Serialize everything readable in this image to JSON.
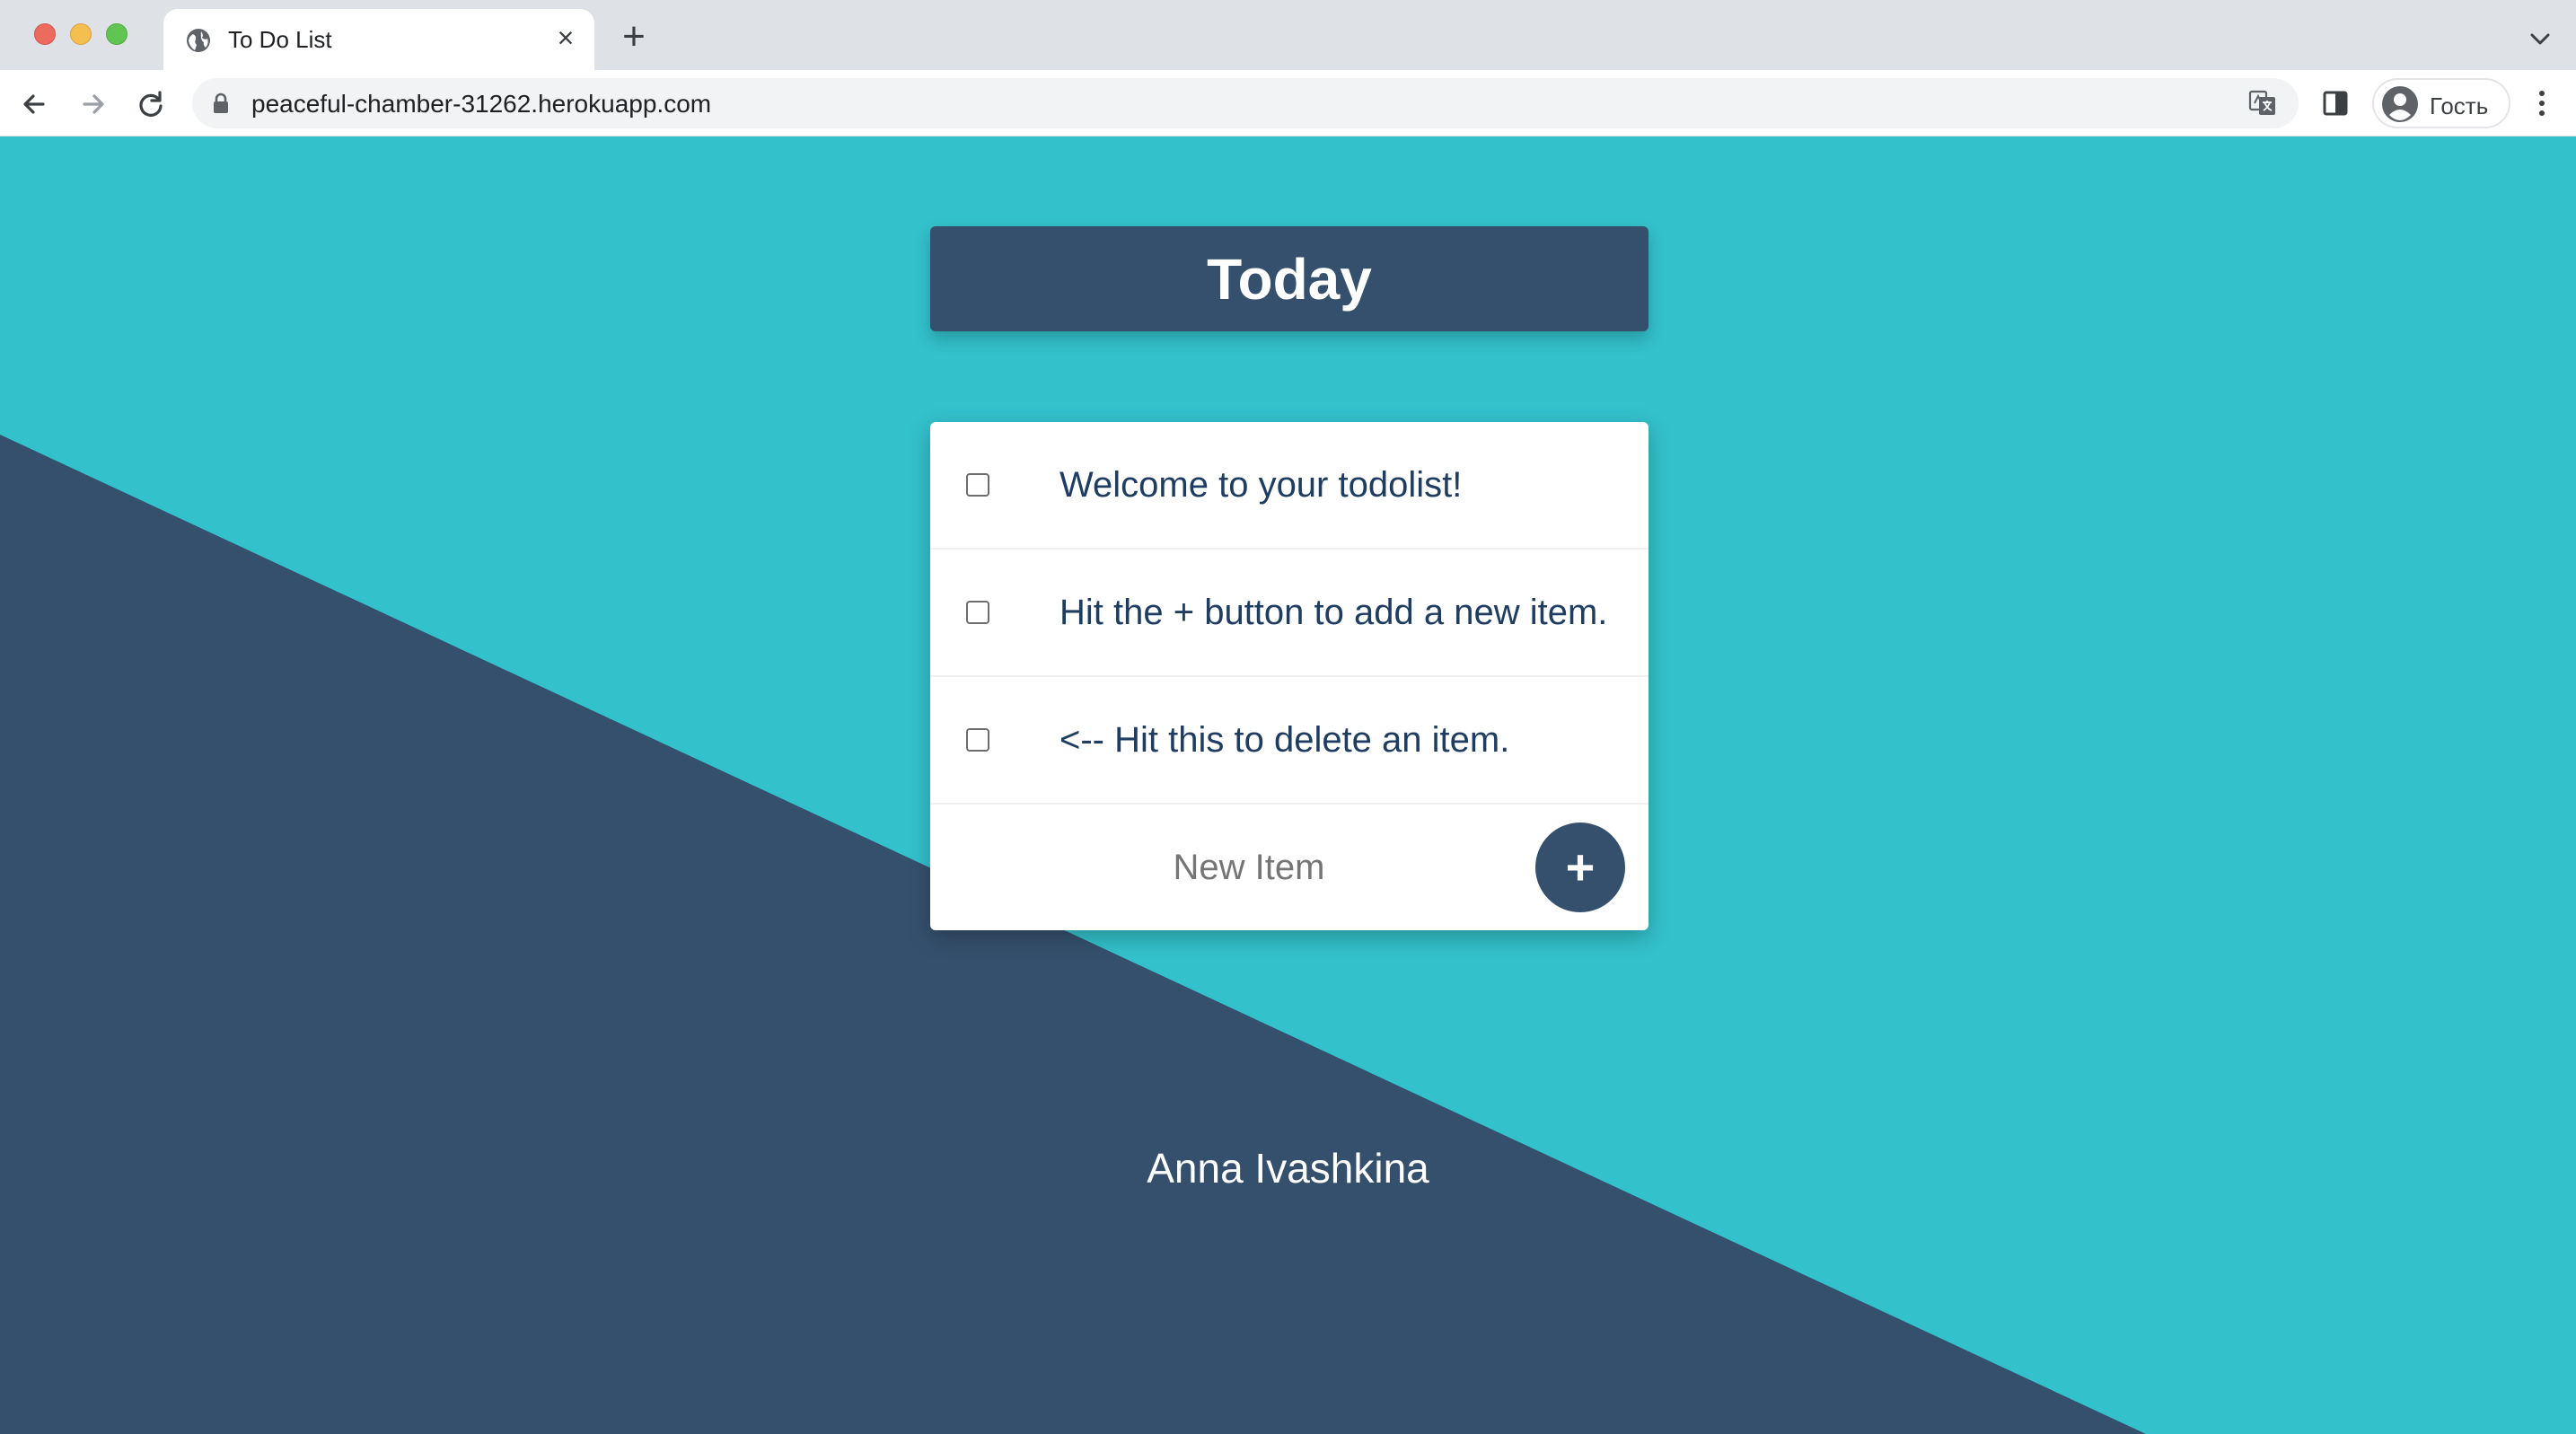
{
  "browser": {
    "tab_title": "To Do List",
    "tab_close": "×",
    "new_tab": "+",
    "url": "peaceful-chamber-31262.herokuapp.com",
    "profile_label": "Гость",
    "icons": {
      "favicon": "globe-icon",
      "back": "arrow-left-icon",
      "forward": "arrow-right-icon",
      "reload": "reload-icon",
      "lock": "lock-icon",
      "translate": "translate-icon",
      "side_panel": "side-panel-icon",
      "profile": "person-icon",
      "menu": "kebab-menu-icon",
      "tab_list": "chevron-down-icon"
    }
  },
  "colors": {
    "background_teal": "#33c1cb",
    "background_navy": "#35506d",
    "item_text": "#1f3d61",
    "card": "#ffffff"
  },
  "page": {
    "heading": "Today",
    "items": [
      {
        "label": "Welcome to your todolist!",
        "checked": false
      },
      {
        "label": "Hit the + button to add a new item.",
        "checked": false
      },
      {
        "label": "<-- Hit this to delete an item.",
        "checked": false
      }
    ],
    "new_item_placeholder": "New Item",
    "add_button_label": "+",
    "footer": "Anna Ivashkina"
  }
}
